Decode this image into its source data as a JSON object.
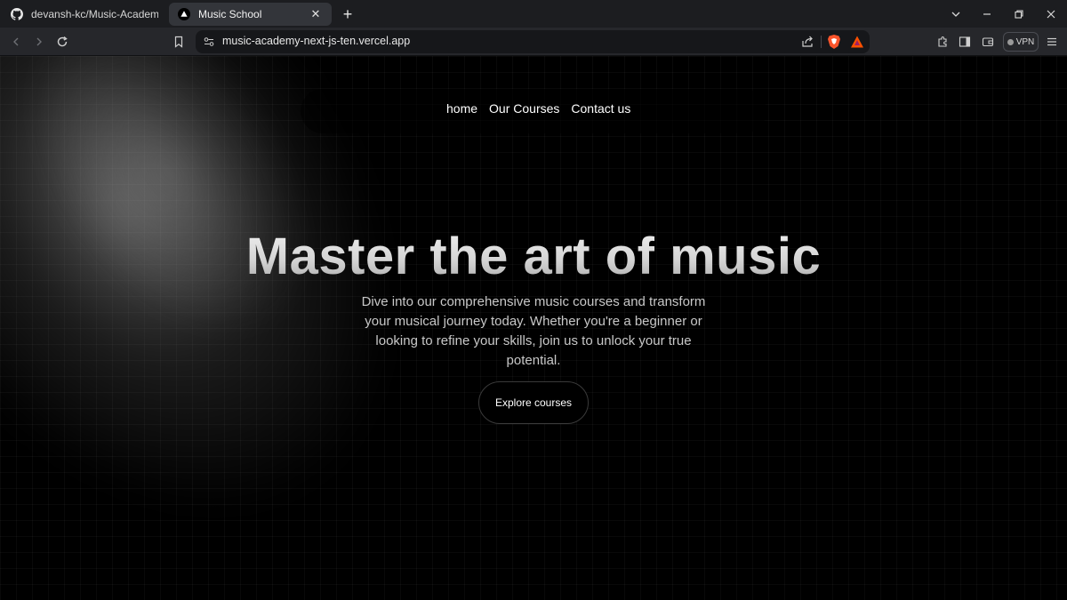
{
  "browser": {
    "tabs": [
      {
        "label": "devansh-kc/Music-Academy-next-js",
        "icon": "github-icon",
        "active": false
      },
      {
        "label": "Music School",
        "icon": "triangle-icon",
        "active": true
      }
    ],
    "url": "music-academy-next-js-ten.vercel.app",
    "vpn_label": "VPN"
  },
  "nav": {
    "items": [
      "home",
      "Our Courses",
      "Contact us"
    ]
  },
  "hero": {
    "title": "Master the art of music",
    "description": "Dive into our comprehensive music courses and transform your musical journey today. Whether you're a beginner or looking to refine your skills, join us to unlock your true potential.",
    "cta_label": "Explore courses"
  },
  "colors": {
    "page_background": "#000000",
    "tab_strip": "#1c1d20",
    "toolbar": "#26272b",
    "url_bar": "#16171a",
    "brave_orange": "#fb542b"
  }
}
